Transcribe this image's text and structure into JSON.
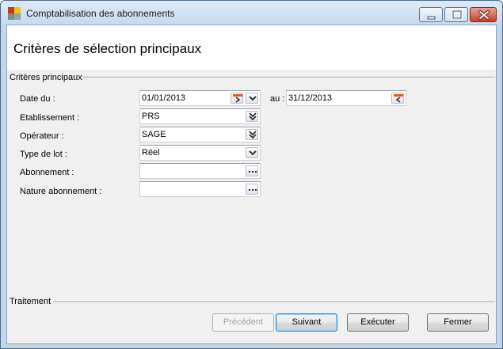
{
  "window": {
    "title": "Comptabilisation des abonnements",
    "accent_color": "#c3d6ea"
  },
  "header": {
    "title": "Critères de sélection principaux"
  },
  "criteria_group": {
    "label": "Critères principaux",
    "fields": {
      "date_from": {
        "label": "Date du :",
        "value": "01/01/2013"
      },
      "date_to": {
        "label": "au :",
        "value": "31/12/2013"
      },
      "etablissement": {
        "label": "Etablissement :",
        "value": "PRS"
      },
      "operateur": {
        "label": "Opérateur :",
        "value": "SAGE"
      },
      "type_lot": {
        "label": "Type de lot :",
        "value": "Réel"
      },
      "abonnement": {
        "label": "Abonnement :",
        "value": ""
      },
      "nature_abonnement": {
        "label": "Nature abonnement :",
        "value": ""
      }
    }
  },
  "treatment_group": {
    "label": "Traitement"
  },
  "buttons": {
    "previous": "Précédent",
    "next": "Suivant",
    "execute": "Exécuter",
    "close": "Fermer"
  }
}
